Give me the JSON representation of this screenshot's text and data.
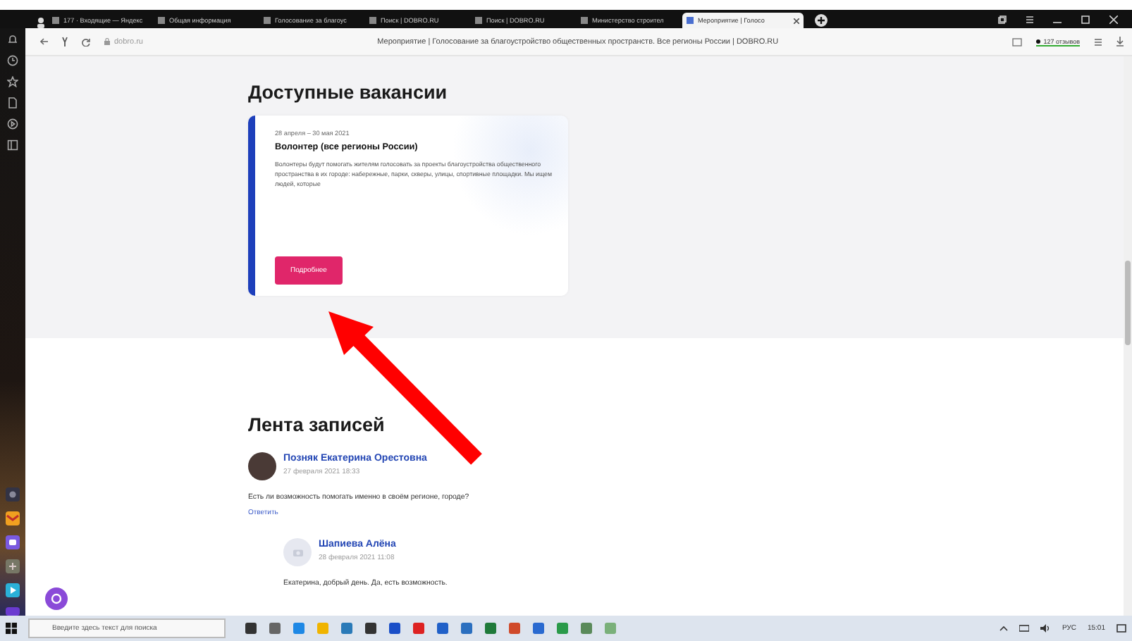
{
  "tabs": [
    {
      "label": "177 · Входящие — Яндекс",
      "selected": false
    },
    {
      "label": "Общая информация",
      "selected": false
    },
    {
      "label": "Голосование за благоус",
      "selected": false
    },
    {
      "label": "Поиск | DOBRO.RU",
      "selected": false
    },
    {
      "label": "Поиск | DOBRO.RU",
      "selected": false
    },
    {
      "label": "Министерство строител",
      "selected": false
    },
    {
      "label": "Мероприятие | Голосо",
      "selected": true
    }
  ],
  "address_bar": {
    "url": "dobro.ru",
    "page_title": "Мероприятие | Голосование за благоустройство общественных пространств. Все регионы России | DOBRO.RU",
    "reviews": "127 отзывов"
  },
  "vacancies": {
    "heading": "Доступные вакансии",
    "card": {
      "dates": "28 апреля – 30 мая 2021",
      "title": "Волонтер (все регионы России)",
      "description": "Волонтеры будут помогать жителям голосовать за проекты благоустройства общественного пространства в их городе: набережные, парки, скверы, улицы, спортивные площадки. Мы ищем людей, которые",
      "button": "Подробнее"
    }
  },
  "feed": {
    "heading": "Лента записей",
    "posts": [
      {
        "author": "Позняк Екатерина Орестовна",
        "date": "27 февраля 2021 18:33",
        "text": "Есть ли возможность помогать именно в своём регионе, городе?",
        "reply": "Ответить",
        "children": [
          {
            "author": "Шапиева Алёна",
            "date": "28 февраля 2021 11:08",
            "text": "Екатерина, добрый день. Да, есть возможность."
          }
        ]
      }
    ]
  },
  "taskbar": {
    "search_placeholder": "Введите здесь текст для поиска",
    "language": "РУС",
    "time": "15:01"
  }
}
